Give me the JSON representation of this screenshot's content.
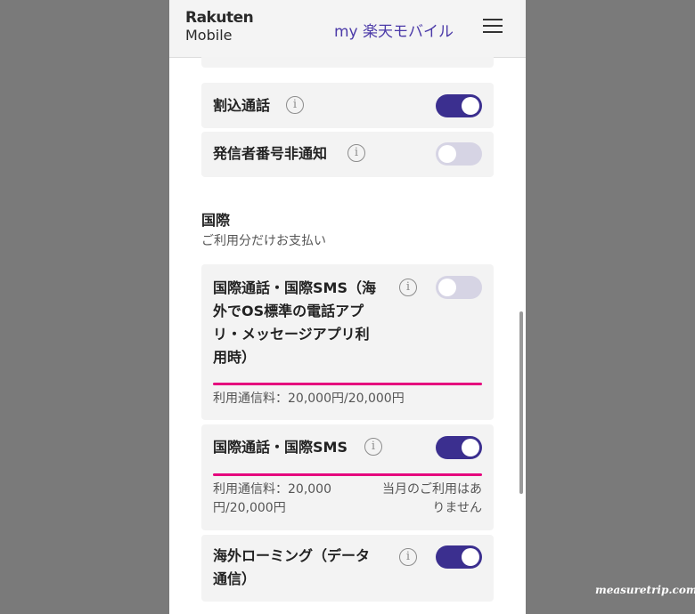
{
  "header": {
    "logo_line1": "Rakuten",
    "logo_line2": "Mobile",
    "title": "my 楽天モバイル",
    "menu_icon": "hamburger-menu-icon"
  },
  "settings": {
    "call_waiting": {
      "label": "割込通話",
      "toggle": "on"
    },
    "caller_id_hide": {
      "label": "発信者番号非通知",
      "toggle": "off"
    }
  },
  "international": {
    "title": "国際",
    "subtitle": "ご利用分だけお支払い",
    "item1": {
      "label_lines": [
        "国際通話・国際SMS（海",
        "外でOS標準の電話アプ",
        "リ・メッセージアプリ利",
        "用時）"
      ],
      "toggle": "off",
      "usage": "利用通信料：20,000円/20,000円"
    },
    "item2": {
      "label": "国際通話・国際SMS",
      "toggle": "on",
      "usage_lines": [
        "利用通信料：20,000",
        "円/20,000円"
      ],
      "note_lines": [
        "当月のご利用はあ",
        "りません"
      ]
    },
    "item3": {
      "label_lines": [
        "海外ローミング（データ",
        "通信）"
      ],
      "toggle": "on"
    }
  },
  "info_icon_glyph": "i",
  "watermark": "measuretrip.com",
  "colors": {
    "accent": "#3b2f8f",
    "bar": "#e5007d",
    "title": "#4b3aa8"
  }
}
